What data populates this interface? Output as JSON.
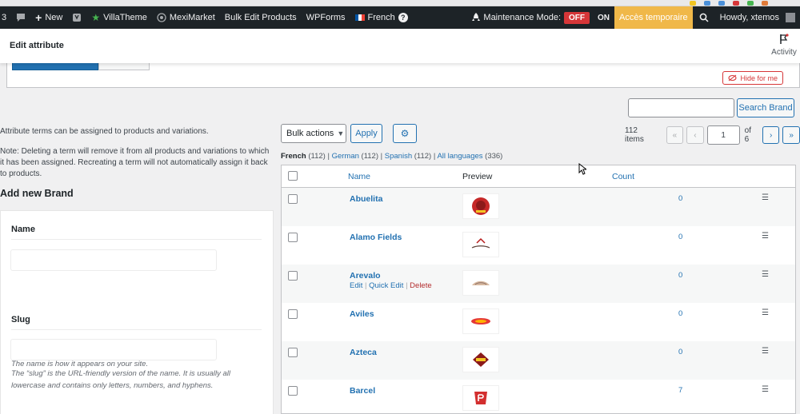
{
  "adminbar": {
    "updates_count": "3",
    "new_label": "New",
    "site_label": "VillaTheme",
    "site2_label": "MexiMarket",
    "bulk_edit_label": "Bulk Edit Products",
    "wpforms_label": "WPForms",
    "language_label": "French",
    "maintenance_label": "Maintenance Mode:",
    "maintenance_off": "OFF",
    "maintenance_on": "ON",
    "acces_label": "Accès temporaire",
    "howdy_label": "Howdy, xtemos"
  },
  "header": {
    "title": "Edit attribute",
    "activity_label": "Activity"
  },
  "notice": {
    "hide_label": "Hide for me"
  },
  "search": {
    "button_label": "Search Brand",
    "value": ""
  },
  "left": {
    "desc1": "Attribute terms can be assigned to products and variations.",
    "desc2": "Note: Deleting a term will remove it from all products and variations to which it has been assigned. Recreating a term will not automatically assign it back to products.",
    "add_new_title": "Add new Brand",
    "name_label": "Name",
    "name_help": "The name is how it appears on your site.",
    "slug_label": "Slug",
    "slug_help": "The “slug” is the URL-friendly version of the name. It is usually all lowercase and contains only letters, numbers, and hyphens."
  },
  "toolbar": {
    "bulk_actions": "Bulk actions",
    "apply_label": "Apply"
  },
  "languages": {
    "current": "French",
    "current_count": "(112)",
    "german": "German",
    "german_count": "(112)",
    "spanish": "Spanish",
    "spanish_count": "(112)",
    "all": "All languages",
    "all_count": "(336)"
  },
  "pagination": {
    "items": "112 items",
    "current_page": "1",
    "of_total": "of 6"
  },
  "table": {
    "col_name": "Name",
    "col_preview": "Preview",
    "col_count": "Count",
    "rows": [
      {
        "name": "Abuelita",
        "count": "0"
      },
      {
        "name": "Alamo Fields",
        "count": "0"
      },
      {
        "name": "Arevalo",
        "count": "0",
        "edit": "Edit",
        "quick_edit": "Quick Edit",
        "delete": "Delete"
      },
      {
        "name": "Aviles",
        "count": "0"
      },
      {
        "name": "Azteca",
        "count": "0"
      },
      {
        "name": "Barcel",
        "count": "7"
      }
    ]
  },
  "colors": {
    "admin_bar": "#1d2327",
    "link": "#2271b1",
    "danger": "#d63638",
    "acces_bg": "#f0b849"
  }
}
